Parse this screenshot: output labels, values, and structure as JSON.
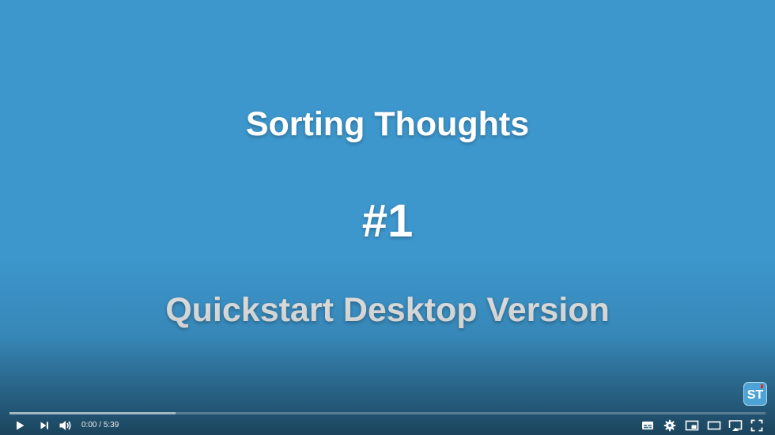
{
  "video": {
    "slide": {
      "title": "Sorting Thoughts",
      "number": "#1",
      "subtitle": "Quickstart Desktop Version",
      "background": "#3d97cd"
    },
    "watermark": {
      "icon": "sorting-thoughts-logo-icon",
      "text": "ST"
    },
    "progress": {
      "played_fraction": 0.0,
      "loaded_fraction": 0.22,
      "played_color": "#ff0000"
    },
    "controls": {
      "current_time": "0:00",
      "separator": " / ",
      "duration": "5:39",
      "icons": {
        "play": "play-icon",
        "next": "next-icon",
        "volume": "volume-icon",
        "subtitles": "subtitles-icon",
        "settings": "gear-icon",
        "miniplayer": "miniplayer-icon",
        "theater": "theater-mode-icon",
        "cast": "cast-icon",
        "fullscreen": "fullscreen-icon"
      }
    }
  }
}
